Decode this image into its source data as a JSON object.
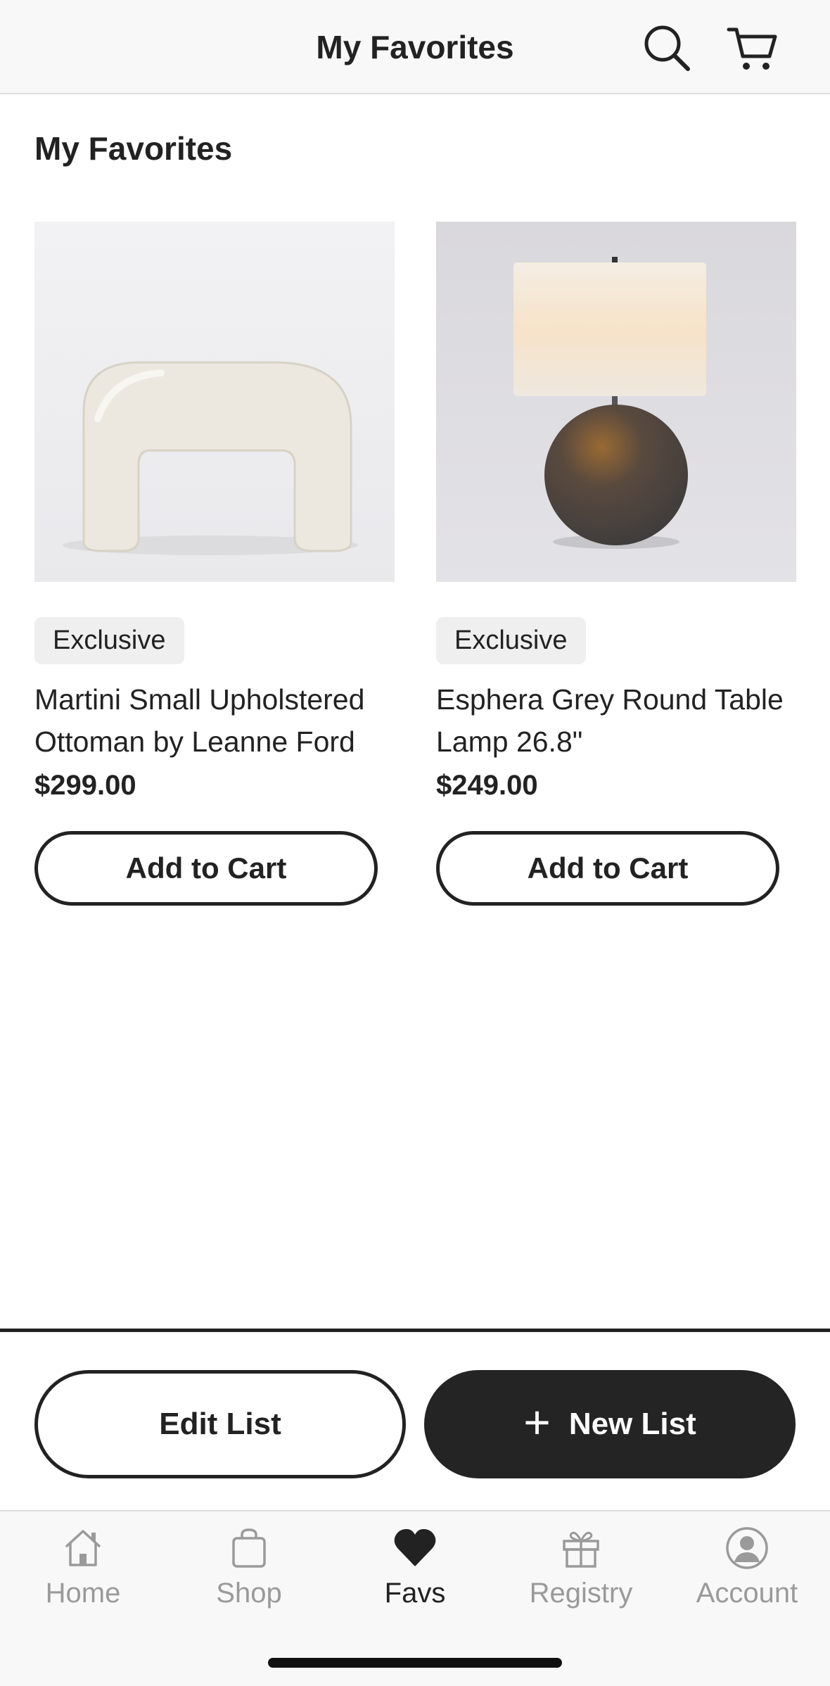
{
  "header": {
    "title": "My Favorites",
    "search_icon": "search-icon",
    "cart_icon": "cart-icon"
  },
  "page": {
    "heading": "My Favorites"
  },
  "products": [
    {
      "badge": "Exclusive",
      "name": "Martini Small Upholstered Ottoman by Leanne Ford",
      "price": "$299.00",
      "button": "Add to Cart"
    },
    {
      "badge": "Exclusive",
      "name": "Esphera Grey Round Table Lamp 26.8\"",
      "price": "$249.00",
      "button": "Add to Cart"
    }
  ],
  "actions": {
    "edit_label": "Edit List",
    "new_label": "New List",
    "new_icon": "+"
  },
  "tabs": [
    {
      "label": "Home",
      "icon": "home-icon",
      "active": false
    },
    {
      "label": "Shop",
      "icon": "shopping-bag-icon",
      "active": false
    },
    {
      "label": "Favs",
      "icon": "heart-icon",
      "active": true
    },
    {
      "label": "Registry",
      "icon": "gift-icon",
      "active": false
    },
    {
      "label": "Account",
      "icon": "account-icon",
      "active": false
    }
  ],
  "colors": {
    "text": "#222222",
    "header_bg": "#f8f8f8",
    "badge_bg": "#efefef",
    "primary_button": "#242424",
    "inactive_tab": "#9a9a9a"
  }
}
